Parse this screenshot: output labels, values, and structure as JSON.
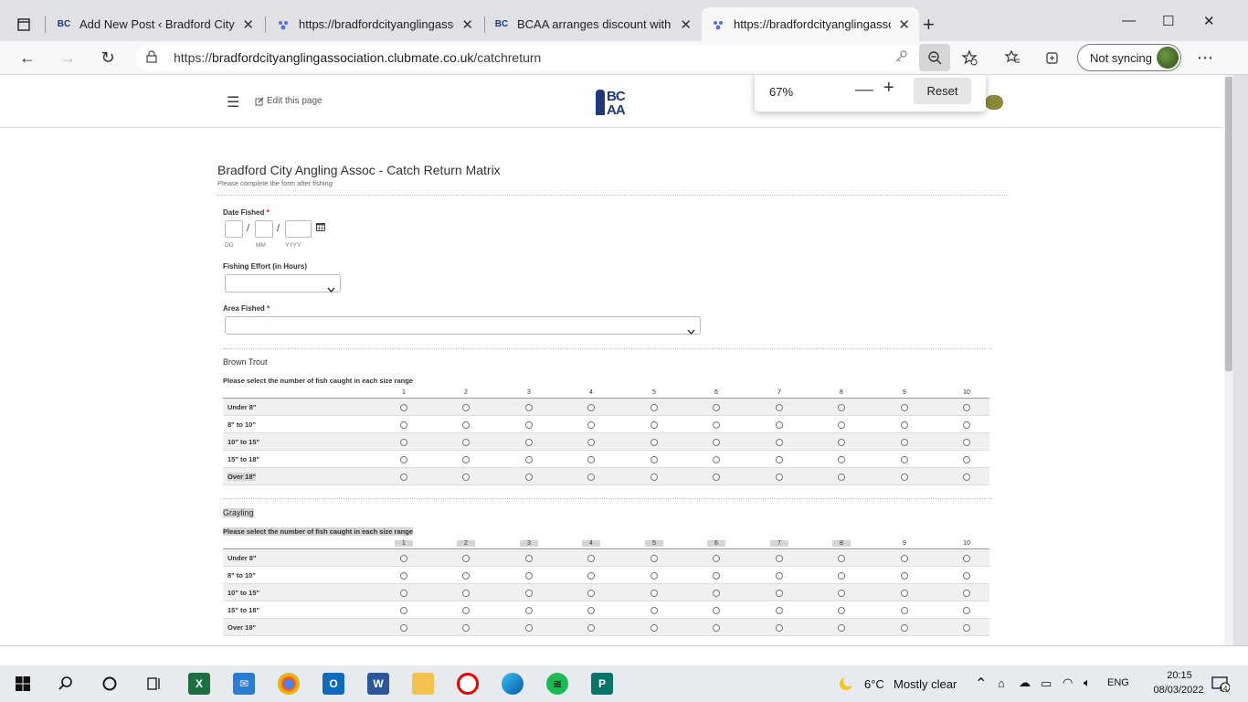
{
  "browser": {
    "tabs": [
      {
        "title": "Add New Post ‹ Bradford City Angling Association",
        "favicon": "bcaa-icon",
        "active": false
      },
      {
        "title": "https://bradfordcityanglingassociation",
        "favicon": "clubmate-icon",
        "active": false
      },
      {
        "title": "BCAA arranges discount with Barracuda",
        "favicon": "bcaa-icon",
        "active": false
      },
      {
        "title": "https://bradfordcityanglingassociation",
        "favicon": "clubmate-icon",
        "active": true
      }
    ],
    "url_prefix": "https://",
    "url_host": "bradfordcityanglingassociation.clubmate.co.uk",
    "url_path": "/catchreturn",
    "sync_label": "Not syncing"
  },
  "zoom_popup": {
    "level": "67%",
    "reset_label": "Reset"
  },
  "site_header": {
    "edit_label": "Edit this page",
    "logo_line1": "BC",
    "logo_line2": "AA"
  },
  "form": {
    "title": "Bradford City Angling Assoc - Catch Return Matrix",
    "subtitle": "Please complete the form after fishing",
    "date_label": "Date Fished",
    "date_required": "*",
    "date_dd": "DD",
    "date_mm": "MM",
    "date_yyyy": "YYYY",
    "date_sep": "/",
    "effort_label": "Fishing Effort (in Hours)",
    "area_label": "Area Fished",
    "area_required": "*"
  },
  "matrices": [
    {
      "title": "Brown Trout",
      "instruction": "Please select the number of fish caught in each size range",
      "columns": [
        "1",
        "2",
        "3",
        "4",
        "5",
        "6",
        "7",
        "8",
        "9",
        "10"
      ],
      "rows": [
        "Under 8\"",
        "8\" to 10\"",
        "10\" to 15\"",
        "15\" to 18\"",
        "Over 18\""
      ]
    },
    {
      "title": "Grayling",
      "instruction": "Please select the number of fish caught in each size range",
      "columns": [
        "1",
        "2",
        "3",
        "4",
        "5",
        "6",
        "7",
        "8",
        "9",
        "10"
      ],
      "rows": [
        "Under 8\"",
        "8\" to 10\"",
        "10\" to 15\"",
        "15\" to 18\"",
        "Over 18\""
      ]
    }
  ],
  "taskbar": {
    "weather_temp": "6°C",
    "weather_desc": "Mostly clear",
    "language": "ENG",
    "time": "20:15",
    "date": "08/03/2022",
    "notifications": "14"
  }
}
